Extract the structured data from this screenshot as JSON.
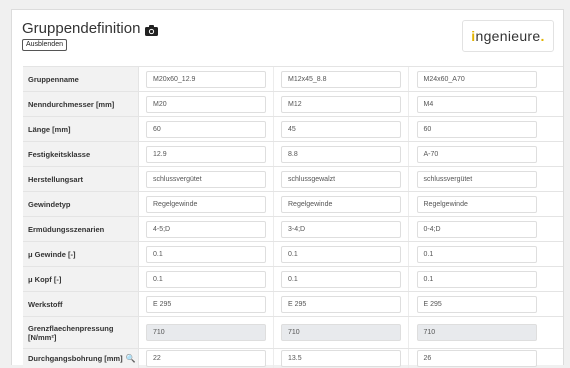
{
  "header": {
    "title": "Gruppendefinition",
    "hide_button": "Ausblenden",
    "logo_text": "ngenieure",
    "logo_i": "i",
    "logo_dot": "."
  },
  "rows": [
    {
      "label": "Gruppenname",
      "values": [
        "M20x60_12.9",
        "M12x45_8.8",
        "M24x60_A70"
      ],
      "readonly": false
    },
    {
      "label": "Nenndurchmesser [mm]",
      "values": [
        "M20",
        "M12",
        "M4"
      ],
      "readonly": false
    },
    {
      "label": "Länge [mm]",
      "values": [
        "60",
        "45",
        "60"
      ],
      "readonly": false
    },
    {
      "label": "Festigkeitsklasse",
      "values": [
        "12.9",
        "8.8",
        "A-70"
      ],
      "readonly": false
    },
    {
      "label": "Herstellungsart",
      "values": [
        "schlussvergütet",
        "schlussgewalzt",
        "schlussvergütet"
      ],
      "readonly": false
    },
    {
      "label": "Gewindetyp",
      "values": [
        "Regelgewinde",
        "Regelgewinde",
        "Regelgewinde"
      ],
      "readonly": false
    },
    {
      "label": "Ermüdungsszenarien",
      "values": [
        "4-5;D",
        "3-4;D",
        "0-4;D"
      ],
      "readonly": false
    },
    {
      "label": "μ Gewinde [-]",
      "values": [
        "0.1",
        "0.1",
        "0.1"
      ],
      "readonly": false
    },
    {
      "label": "μ Kopf [-]",
      "values": [
        "0.1",
        "0.1",
        "0.1"
      ],
      "readonly": false
    },
    {
      "label": "Werkstoff",
      "values": [
        "E 295",
        "E 295",
        "E 295"
      ],
      "readonly": false
    },
    {
      "label": "Grenzflaechenpressung [N/mm²]",
      "values": [
        "710",
        "710",
        "710"
      ],
      "readonly": true
    },
    {
      "label": "Durchgangsbohrung [mm]",
      "values": [
        "22",
        "13.5",
        "26"
      ],
      "readonly": false,
      "has_search_icon": true
    }
  ],
  "colors": {
    "page_bg": "#f0f0f0",
    "label_bg": "#f2f2f2",
    "readonly_bg": "#e8eaed",
    "logo_accent": "#e3b400"
  }
}
